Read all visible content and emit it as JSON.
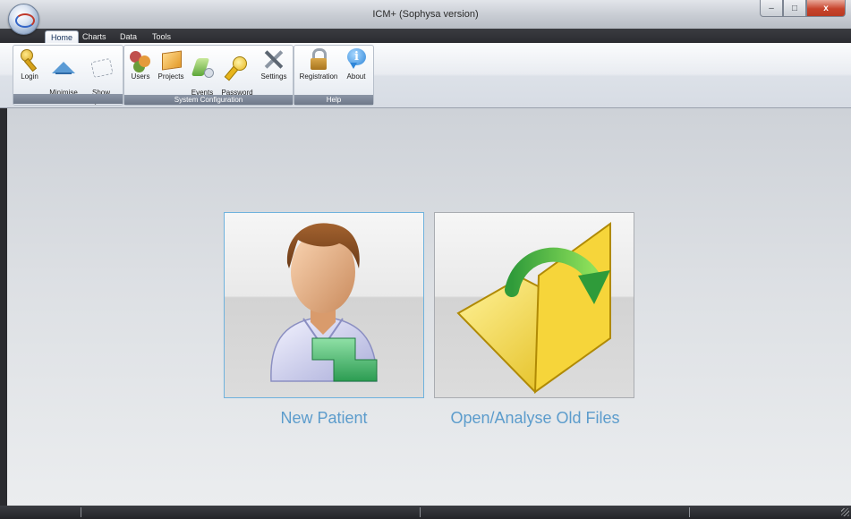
{
  "window": {
    "title": "ICM+ (Sophysa version)",
    "controls": {
      "minimize": "–",
      "maximize": "□",
      "close": "x"
    }
  },
  "tabs": [
    {
      "label": "Home",
      "active": true
    },
    {
      "label": "Charts",
      "active": false
    },
    {
      "label": "Data",
      "active": false
    },
    {
      "label": "Tools",
      "active": false
    }
  ],
  "ribbon": {
    "groups": [
      {
        "label": "",
        "buttons": [
          {
            "label": "Login",
            "icon": "key-icon"
          },
          {
            "label": "Minimise\nRibbon",
            "icon": "minimise-ribbon-icon"
          },
          {
            "label": "Show\nKeyboard",
            "icon": "keyboard-icon"
          }
        ]
      },
      {
        "label": "System Configuration",
        "buttons": [
          {
            "label": "Users",
            "icon": "users-icon"
          },
          {
            "label": "Projects",
            "icon": "projects-box-icon"
          },
          {
            "label": "Events\nConfig",
            "icon": "events-config-icon"
          },
          {
            "label": "Password\nChange",
            "icon": "password-key-icon"
          },
          {
            "label": "Settings",
            "icon": "settings-tools-icon"
          }
        ]
      },
      {
        "label": "Help",
        "buttons": [
          {
            "label": "Registration",
            "icon": "lock-icon"
          },
          {
            "label": "About",
            "icon": "info-icon"
          }
        ]
      }
    ]
  },
  "main": {
    "actions": [
      {
        "label": "New Patient",
        "icon": "new-patient-icon",
        "focused": true
      },
      {
        "label": "Open/Analyse Old Files",
        "icon": "open-folder-icon",
        "focused": false
      }
    ]
  },
  "colors": {
    "action_label": "#5c9ccc",
    "focus_border": "#6fb2dd",
    "ribbon_group_label_bg": "#7a8494"
  }
}
